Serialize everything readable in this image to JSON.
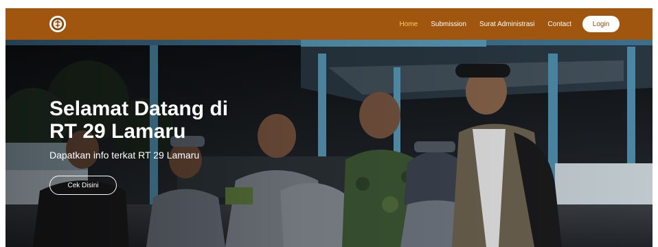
{
  "nav": {
    "logo_icon": "village-emblem-logo",
    "links": [
      {
        "label": "Home",
        "active": true
      },
      {
        "label": "Submission"
      },
      {
        "label": "Surat Administrasi"
      },
      {
        "label": "Contact"
      }
    ],
    "login_label": "Login",
    "bar_color": "#a0560e",
    "active_color": "#ffcf66"
  },
  "hero": {
    "title_line1": "Selamat Datang di",
    "title_line2": "RT 29 Lamaru",
    "subtitle": "Dapatkan info terkat RT 29 Lamaru",
    "cta_label": "Cek Disini",
    "background": "night-photo-group-of-officials-in-uniforms"
  }
}
